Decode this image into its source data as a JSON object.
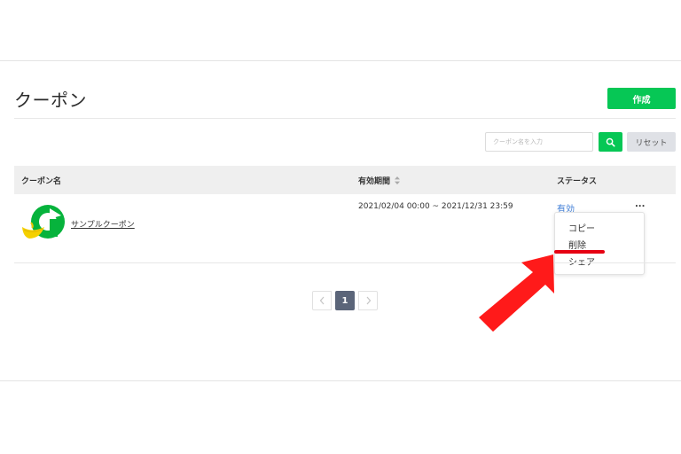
{
  "page": {
    "title": "クーポン",
    "create_label": "作成"
  },
  "search": {
    "placeholder": "クーポン名を入力",
    "reset_label": "リセット"
  },
  "table": {
    "columns": {
      "name": "クーポン名",
      "period": "有効期間",
      "status": "ステータス"
    },
    "rows": [
      {
        "name": "サンプルクーポン",
        "period": "2021/02/04 00:00 ~ 2021/12/31 23:59",
        "status": "有効",
        "more": "..."
      }
    ]
  },
  "dropdown": {
    "items": [
      "コピー",
      "削除",
      "シェア"
    ]
  },
  "pagination": {
    "current": "1"
  },
  "colors": {
    "accent_green": "#06c755",
    "status_blue": "#3b7bd6",
    "annotation_red": "#e60012",
    "pagination_active": "#5b6579"
  }
}
